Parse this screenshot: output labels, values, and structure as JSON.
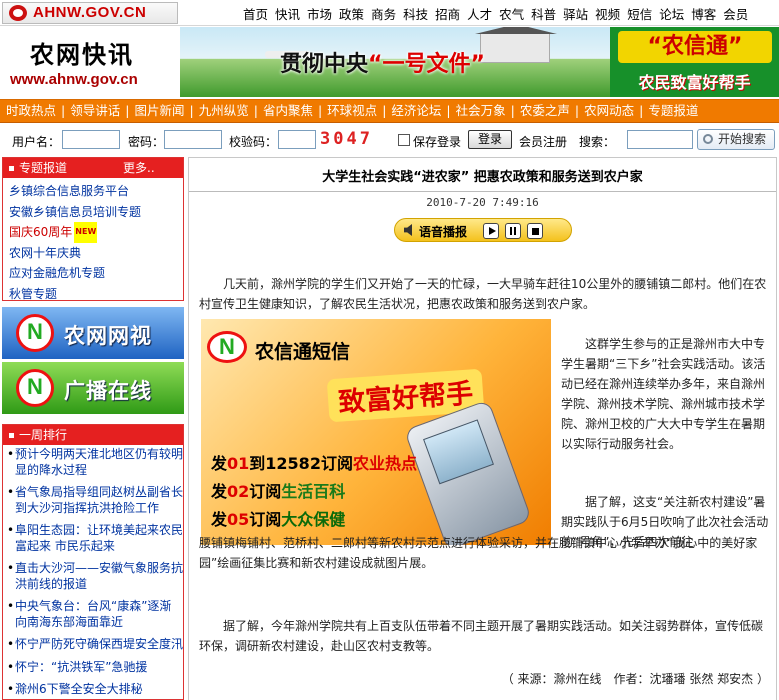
{
  "site": {
    "small_logo_text": "AHNW.GOV.CN",
    "brand_name": "农网快讯",
    "brand_url": "www.ahnw.gov.cn"
  },
  "top_nav": [
    "首页",
    "快讯",
    "市场",
    "政策",
    "商务",
    "科技",
    "招商",
    "人才",
    "农气",
    "科普",
    "驿站",
    "视频",
    "短信",
    "论坛",
    "博客",
    "会员"
  ],
  "banner": {
    "slogan_pre": "贯彻中央",
    "slogan_highlight": "“一号文件”",
    "promo_title": "“农信通”",
    "promo_sub": "农民致富好帮手"
  },
  "main_nav": [
    "时政热点",
    "领导讲话",
    "图片新闻",
    "九州纵览",
    "省内聚焦",
    "环球视点",
    "经济论坛",
    "社会万象",
    "农委之声",
    "农网动态",
    "专题报道"
  ],
  "login": {
    "username_label": "用户名：",
    "password_label": "密码：",
    "captcha_label": "校验码：",
    "captcha_value": "3047",
    "save_label": "保存登录",
    "login_button": "登录",
    "register_label": "会员注册",
    "search_label": "搜索：",
    "search_button": "开始搜索"
  },
  "sidebar": {
    "special_title": "专题报道",
    "more_label": "更多..",
    "new_badge": "NEW",
    "special_items": [
      "乡镇综合信息服务平台",
      "安徽乡镇信息员培训专题",
      "国庆60周年",
      "农网十年庆典",
      "应对金融危机专题",
      "秋管专题"
    ],
    "feature_tv": "农网网视",
    "feature_radio": "广播在线",
    "rank_title": "一周排行",
    "rank_items": [
      "预计今明两天淮北地区仍有较明显的降水过程",
      "省气象局指导组同赵树丛副省长到大沙河指挥抗洪抢险工作",
      "阜阳生态园：让环境美起来农民富起来 市民乐起来",
      "直击大沙河——安徽气象服务抗洪前线的报道",
      "中央气象台：台风“康森”逐渐向南海东部海面靠近",
      "怀宁严防死守确保西堤安全度汛",
      "怀宁：“抗洪铁军”急驰援",
      "滁州6下警全安全大排秘"
    ]
  },
  "article": {
    "title": "大学生社会实践“进农家” 把惠农政策和服务送到农户家",
    "date": "2010-7-20 7:49:16",
    "player_label": "语音播报",
    "p1": "几天前，滁州学院的学生们又开始了一天的忙碌，一大早骑车赶往10公里外的腰铺镇二郎村。他们在农村宣传卫生健康知识，了解农民生活状况，把惠农政策和服务送到农户家。",
    "p2": "这群学生参与的正是滁州市大中专学生暑期“三下乡”社会实践活动。该活动已经在滁州连续举办多年，来自滁州学院、滁州技术学院、滁州城市技术学院、滁州卫校的广大大中专学生在暑期以实际行动服务社会。",
    "p3": "据了解，这支“关注新农村建设”暑期实践队于6月5日吹响了此次社会活动的“号角”，先后四次前往",
    "p3b": "腰铺镇梅铺村、范桥村、二郎村等新农村示范点进行体验采访，并在腰铺镇中心小学举办“我心中的美好家园”绘画征集比赛和新农村建设成就图片展。",
    "p4": "据了解，今年滁州学院共有上百支队伍带着不同主题开展了暑期实践活动。如关注弱势群体，宣传低碳环保，调研新农村建设，赴山区农村支教等。",
    "source": "（ 来源：滁州在线　作者：沈璠璠 张然 郑安杰 ）"
  },
  "ad": {
    "title": "农信通短信",
    "slogan": "致富好帮手",
    "line1_pre": "发",
    "line1_num": "01",
    "line1_mid": "到12582订阅",
    "line1_topic": "农业热点",
    "line2_pre": "发",
    "line2_num": "02",
    "line2_mid": "订阅",
    "line2_topic": "生活百科",
    "line3_pre": "发",
    "line3_num": "05",
    "line3_mid": "订阅",
    "line3_topic": "大众保健"
  }
}
